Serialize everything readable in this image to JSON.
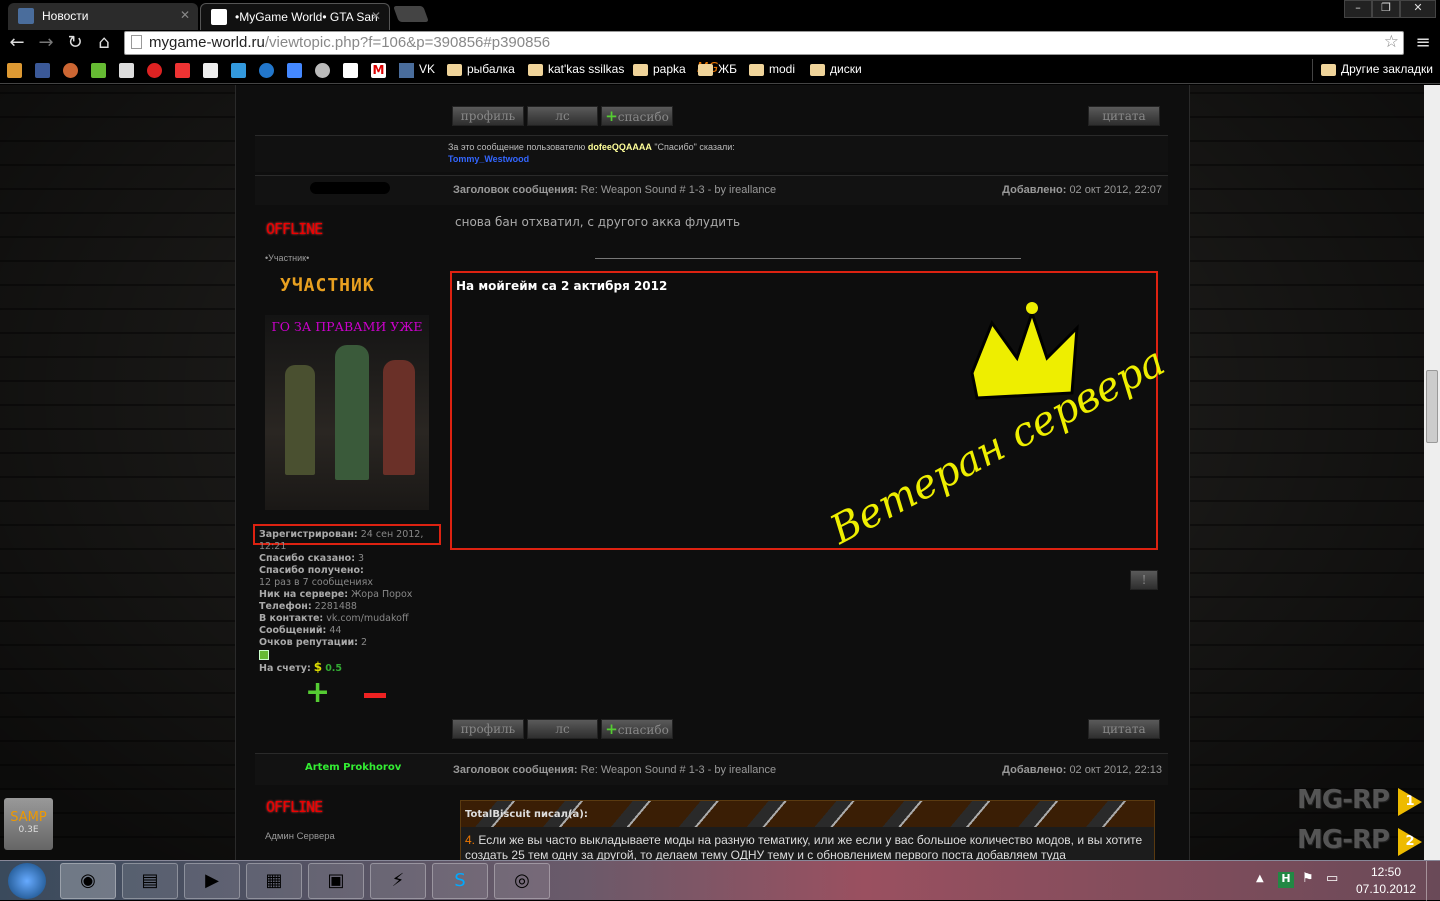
{
  "browser": {
    "tabs": [
      {
        "label": "Новости",
        "icon": "vk-icon"
      },
      {
        "label": "•MyGame World• GTA San",
        "icon": "mygame-icon"
      }
    ],
    "url_domain": "mygame-world.ru",
    "url_path": "/viewtopic.php?f=106&p=390856#p390856",
    "bookmarks": {
      "vk": "VK",
      "folders": [
        "рыбалка",
        "kat'kas ssilkas",
        "papka"
      ],
      "mg": "ЖБ",
      "folders2": [
        "modi",
        "диски"
      ],
      "other": "Другие закладки"
    }
  },
  "post_buttons": {
    "profile": "профиль",
    "pm": "лс",
    "thanks": "спасибо",
    "quote": "цитата",
    "report": "!"
  },
  "thanks_row": {
    "prefix": "За это сообщение пользователю",
    "user": "dofeeQQAAAA",
    "suffix": "\"Спасибо\" сказали:",
    "thanker": "Tommy_Westwood"
  },
  "post1": {
    "subject_label": "Заголовок сообщения:",
    "subject": "Re: Weapon Sound # 1-3 - by ireallance",
    "added_label": "Добавлено:",
    "added": "02 окт 2012, 22:07",
    "body": "снова бан отхватил, с другого акка флудить",
    "status": "OFFLINE",
    "rank": "•Участник•",
    "rank_image_text": "УЧАСТНИК",
    "avatar_caption": "ГО ЗА ПРАВАМИ УЖЕ",
    "signature_title": "На мойгейм са 2 актибря 2012",
    "signature_art": "Ветеран сервера",
    "info": [
      {
        "k": "Зарегистрирован:",
        "v": "24 сен 2012, 12:21"
      },
      {
        "k": "Спасибо сказано:",
        "v": "3"
      },
      {
        "k": "Спасибо получено:",
        "v": ""
      },
      {
        "k": "",
        "v": "12 раз в 7 сообщениях"
      },
      {
        "k": "Ник на сервере:",
        "v": "Жора Порох"
      },
      {
        "k": "Телефон:",
        "v": "2281488"
      },
      {
        "k": "В контакте:",
        "v": "vk.com/mudakoff"
      },
      {
        "k": "Сообщений:",
        "v": "44"
      },
      {
        "k": "Очков репутации:",
        "v": "2"
      }
    ],
    "balance_label": "На счету:",
    "balance": "0.5"
  },
  "post2": {
    "author": "Artem Prokhorov",
    "status": "OFFLINE",
    "rank": "Админ Сервера",
    "subject_label": "Заголовок сообщения:",
    "subject": "Re: Weapon Sound # 1-3 - by ireallance",
    "added_label": "Добавлено:",
    "added": "02 окт 2012, 22:13",
    "quote_author": "TotalBiscuit писал(а):",
    "quote_num": "4.",
    "quote_text": "Если же вы часто выкладываете моды на разную тематику, или же если у вас большое количество модов, и вы хотите создать 25 тем одну за другой, то делаем тему ОДНУ тему и с обновлением первого поста добавляем туда"
  },
  "side": {
    "samp": "SAMP",
    "samp_ver": "0.3E",
    "mgrp1": "MG-RP",
    "n1": "1",
    "mgrp2": "MG-RP",
    "n2": "2"
  },
  "taskbar": {
    "time": "12:50",
    "date": "07.10.2012"
  }
}
